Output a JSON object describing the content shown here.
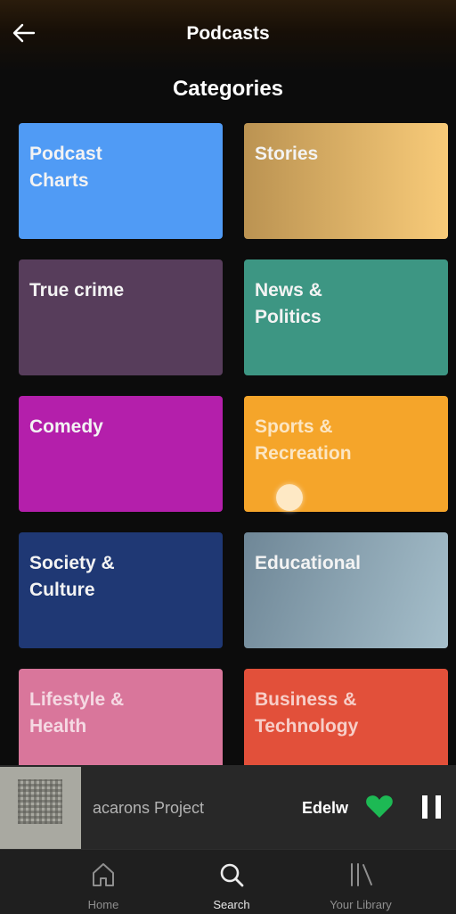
{
  "header": {
    "title": "Podcasts",
    "back_icon": "arrow-left-icon"
  },
  "section_title": "Categories",
  "categories": [
    {
      "label": "Podcast\nCharts",
      "color": "#509bf5"
    },
    {
      "label": "Stories",
      "color": "#d1a95a"
    },
    {
      "label": "True crime",
      "color": "#573d5b"
    },
    {
      "label": "News &\nPolitics",
      "color": "#3d9683"
    },
    {
      "label": "Comedy",
      "color": "#b41fab"
    },
    {
      "label": "Sports &\nRecreation",
      "color": "#f5a52a"
    },
    {
      "label": "Society &\nCulture",
      "color": "#1f3874"
    },
    {
      "label": "Educational",
      "color": "#8fa9b8"
    },
    {
      "label": "Lifestyle &\nHealth",
      "color": "#d9769b"
    },
    {
      "label": "Business &\nTechnology",
      "color": "#e2503a"
    }
  ],
  "now_playing": {
    "track": "acarons Project",
    "artist": "Edelw",
    "heart_icon": "heart-filled-icon",
    "pause_icon": "pause-icon",
    "accent_color": "#1db954"
  },
  "nav": [
    {
      "label": "Home",
      "icon": "home-icon"
    },
    {
      "label": "Search",
      "icon": "search-icon"
    },
    {
      "label": "Your Library",
      "icon": "library-icon"
    }
  ]
}
